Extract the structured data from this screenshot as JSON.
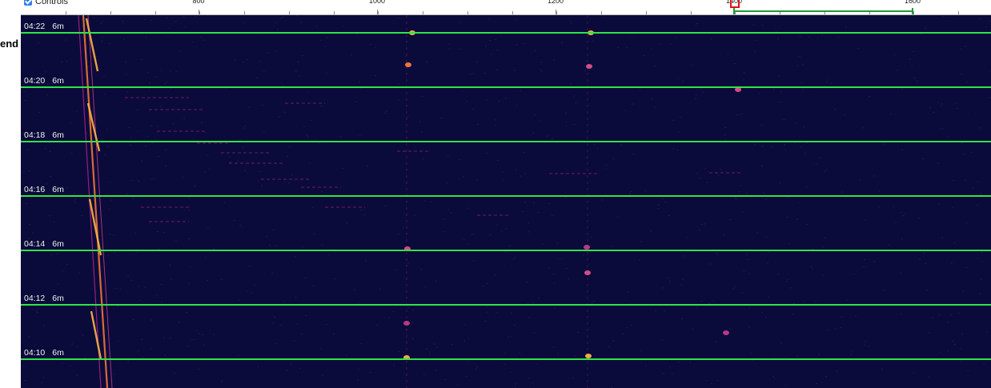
{
  "legend": {
    "label": "end"
  },
  "controls": {
    "label": "Controls",
    "checked": true
  },
  "ruler": {
    "ticks": [
      {
        "label": "800"
      },
      {
        "label": "1000"
      },
      {
        "label": "1200"
      },
      {
        "label": "1400"
      },
      {
        "label": "1600"
      }
    ]
  },
  "waterfall": {
    "rows": [
      {
        "time": "04:22",
        "span": "6m"
      },
      {
        "time": "04:20",
        "span": "6m"
      },
      {
        "time": "04:18",
        "span": "6m"
      },
      {
        "time": "04:16",
        "span": "6m"
      },
      {
        "time": "04:14",
        "span": "6m"
      },
      {
        "time": "04:12",
        "span": "6m"
      },
      {
        "time": "04:10",
        "span": "6m"
      }
    ]
  },
  "colors": {
    "background": "#0a0b3a",
    "timestamp_line": "#32e24a",
    "passband": "#1f9a3a",
    "cursor": "#e11111",
    "signal_hot": "#ffb347",
    "signal_warm": "#d0208a"
  }
}
